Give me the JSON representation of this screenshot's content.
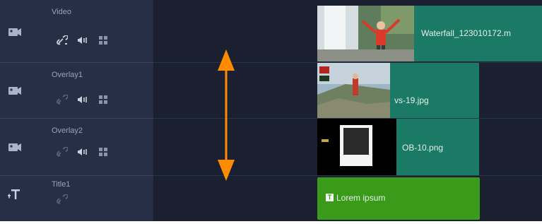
{
  "tracks": [
    {
      "name": "Video",
      "type_icon": "video-track-icon"
    },
    {
      "name": "Overlay1",
      "type_icon": "video-track-icon"
    },
    {
      "name": "Overlay2",
      "type_icon": "video-track-icon"
    },
    {
      "name": "Title1",
      "type_icon": "title-track-icon"
    }
  ],
  "clips": {
    "video": {
      "label": "Waterfall_123010172.m"
    },
    "overlay1": {
      "label": "vs-19.jpg"
    },
    "overlay2": {
      "label": "OB-10.png"
    },
    "title": {
      "label": "Lorem ipsum",
      "badge": "T"
    }
  },
  "colors": {
    "clip_teal": "#1a7a65",
    "title_green": "#3a9a1a",
    "arrow_orange": "#ff8c00",
    "header_bg": "#262f45"
  }
}
